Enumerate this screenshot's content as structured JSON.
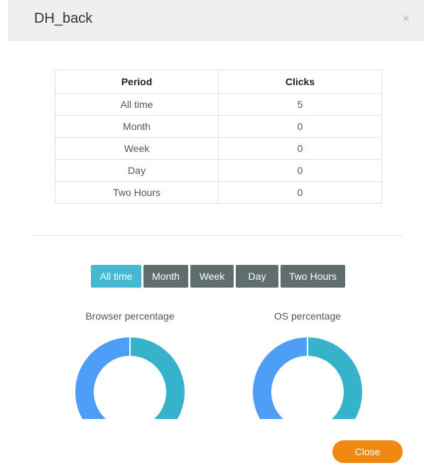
{
  "modal": {
    "title": "DH_back",
    "close_icon": "×"
  },
  "stats_table": {
    "headers": [
      "Period",
      "Clicks"
    ],
    "rows": [
      {
        "period": "All time",
        "clicks": "5"
      },
      {
        "period": "Month",
        "clicks": "0"
      },
      {
        "period": "Week",
        "clicks": "0"
      },
      {
        "period": "Day",
        "clicks": "0"
      },
      {
        "period": "Two Hours",
        "clicks": "0"
      }
    ]
  },
  "period_buttons": {
    "all_time": "All time",
    "month": "Month",
    "week": "Week",
    "day": "Day",
    "two_hours": "Two Hours",
    "active": "All time"
  },
  "charts": {
    "browser_title": "Browser percentage",
    "os_title": "OS percentage"
  },
  "chart_data": [
    {
      "type": "pie",
      "title": "Browser percentage",
      "series": [
        {
          "values": [
            50,
            50
          ]
        }
      ],
      "colors": [
        "#36b3cb",
        "#4e9ef7"
      ]
    },
    {
      "type": "pie",
      "title": "OS percentage",
      "series": [
        {
          "values": [
            50,
            50
          ]
        }
      ],
      "colors": [
        "#36b3cb",
        "#4e9ef7"
      ]
    }
  ],
  "footer": {
    "close_label": "Close"
  },
  "colors": {
    "header_bg": "#edeff1",
    "active_button": "#46b8cf",
    "inactive_button": "#5f6d6e",
    "close_button": "#ee8a10"
  }
}
